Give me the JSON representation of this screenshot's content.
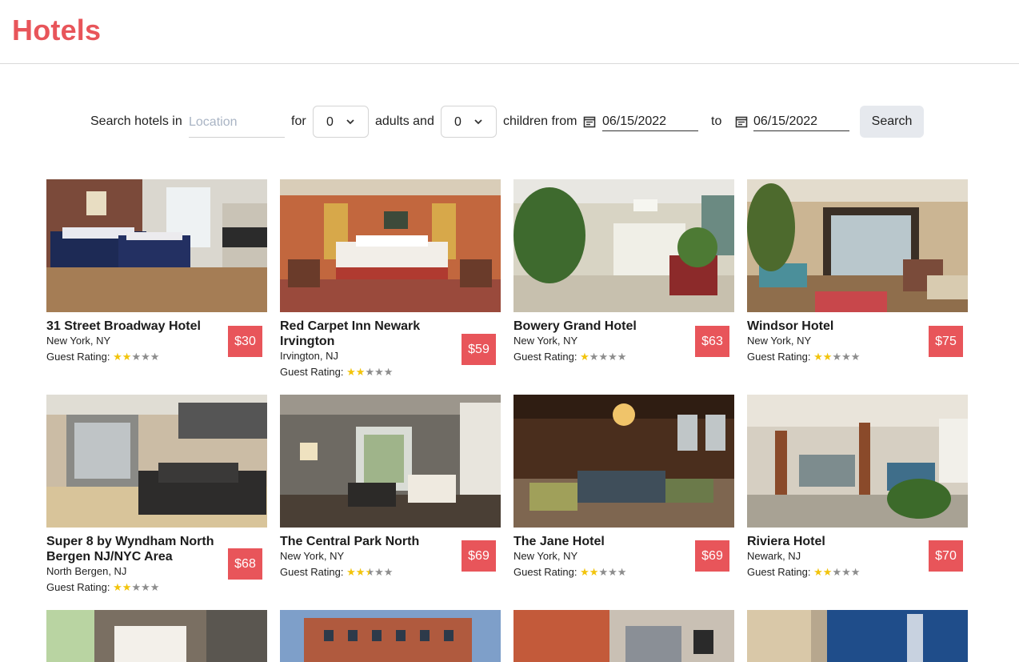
{
  "app": {
    "title": "Hotels"
  },
  "search": {
    "prefix": "Search hotels in",
    "location_placeholder": "Location",
    "location_value": "",
    "for_label": "for",
    "adults_value": "0",
    "adults_label": "adults and",
    "children_value": "0",
    "children_label": "children from",
    "from_date": "06/15/2022",
    "to_label": "to",
    "to_date": "06/15/2022",
    "button_label": "Search"
  },
  "colors": {
    "brand": "#e8555a",
    "star": "#f2c40c",
    "price_bg": "#e8555a"
  },
  "rating_label": "Guest Rating:",
  "hotels": [
    {
      "name": "31 Street Broadway Hotel",
      "city": "New York, NY",
      "price": "$30",
      "rating": 2,
      "image": "hotel-room-photo"
    },
    {
      "name": "Red Carpet Inn Newark Irvington",
      "city": "Irvington, NJ",
      "price": "$59",
      "rating": 2,
      "image": "hotel-room-photo"
    },
    {
      "name": "Bowery Grand Hotel",
      "city": "New York, NY",
      "price": "$63",
      "rating": 1,
      "image": "hotel-lobby-photo"
    },
    {
      "name": "Windsor Hotel",
      "city": "New York, NY",
      "price": "$75",
      "rating": 2,
      "image": "hotel-lobby-photo"
    },
    {
      "name": "Super 8 by Wyndham North Bergen NJ/NYC Area",
      "city": "North Bergen, NJ",
      "price": "$68",
      "rating": 2,
      "image": "hotel-lobby-photo"
    },
    {
      "name": "The Central Park North",
      "city": "New York, NY",
      "price": "$69",
      "rating": 2.5,
      "image": "hotel-room-photo"
    },
    {
      "name": "The Jane Hotel",
      "city": "New York, NY",
      "price": "$69",
      "rating": 2,
      "image": "hotel-lobby-photo"
    },
    {
      "name": "Riviera Hotel",
      "city": "Newark, NJ",
      "price": "$70",
      "rating": 2,
      "image": "hotel-lobby-photo"
    }
  ]
}
